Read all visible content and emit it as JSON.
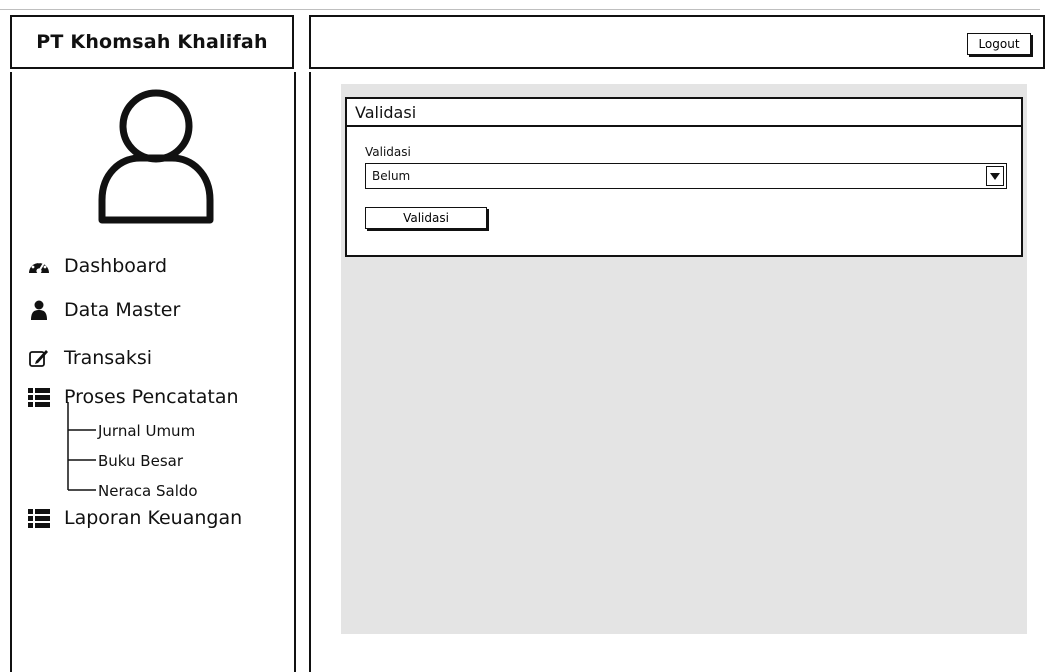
{
  "app": {
    "title": "PT Khomsah Khalifah"
  },
  "header": {
    "logout_label": "Logout"
  },
  "sidebar": {
    "items": [
      {
        "label": "Dashboard",
        "icon": "dashboard-icon"
      },
      {
        "label": "Data Master",
        "icon": "user-icon"
      },
      {
        "label": "Transaksi",
        "icon": "edit-icon"
      },
      {
        "label": "Proses Pencatatan",
        "icon": "list-icon"
      },
      {
        "label": "Laporan Keuangan",
        "icon": "list-icon"
      }
    ],
    "sub_items": [
      "Jurnal Umum",
      "Buku Besar",
      "Neraca Saldo"
    ]
  },
  "panel": {
    "title": "Validasi",
    "field_label": "Validasi",
    "select_value": "Belum",
    "button_label": "Validasi"
  }
}
